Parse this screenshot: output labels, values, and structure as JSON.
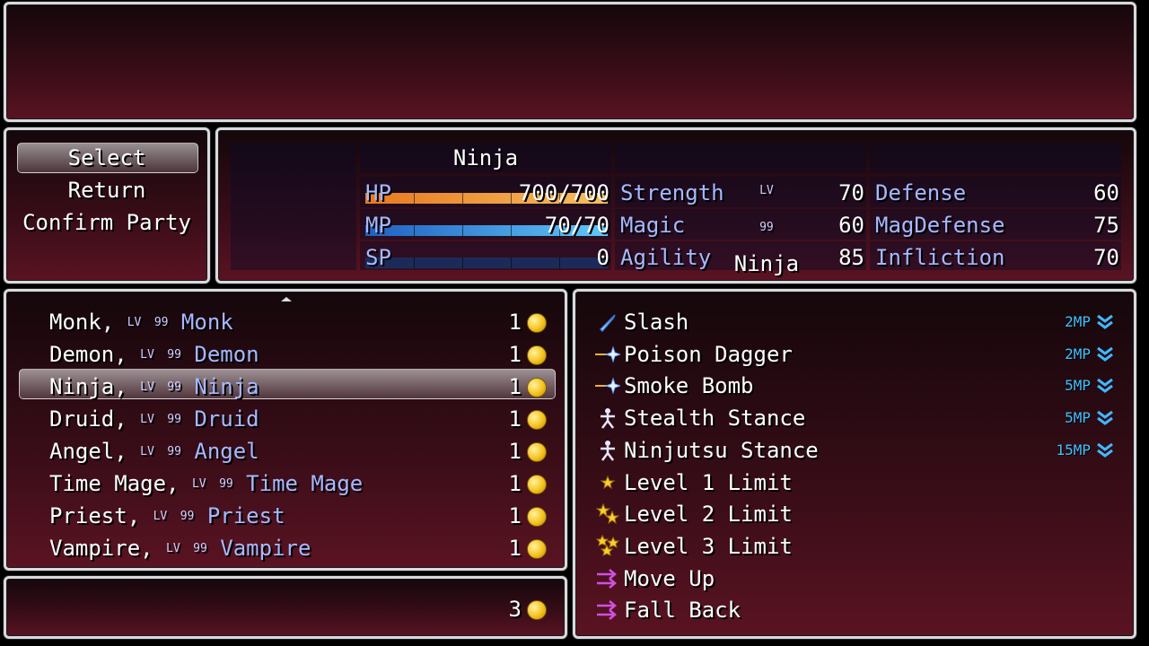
{
  "help": {
    "text": ""
  },
  "command": {
    "items": [
      "Select",
      "Return",
      "Confirm Party"
    ]
  },
  "status": {
    "name": "Ninja",
    "level_label": "LV",
    "level": "99",
    "class": "Ninja",
    "hp_label": "HP",
    "hp_value": "700/700",
    "hp_fill": 1.0,
    "mp_label": "MP",
    "mp_value": "70/70",
    "mp_fill": 1.0,
    "sp_label": "SP",
    "sp_value": "0",
    "sp_fill": 0.0,
    "params": [
      {
        "label": "Strength",
        "value": "70"
      },
      {
        "label": "Defense",
        "value": "60"
      },
      {
        "label": "Magic",
        "value": "60"
      },
      {
        "label": "MagDefense",
        "value": "75"
      },
      {
        "label": "Agility",
        "value": "85"
      },
      {
        "label": "Infliction",
        "value": "70"
      }
    ]
  },
  "party_list": {
    "items": [
      {
        "name": "Monk,",
        "lv": "LV",
        "level": "99",
        "class": "Monk",
        "cost": "1"
      },
      {
        "name": "Demon,",
        "lv": "LV",
        "level": "99",
        "class": "Demon",
        "cost": "1"
      },
      {
        "name": "Ninja,",
        "lv": "LV",
        "level": "99",
        "class": "Ninja",
        "cost": "1"
      },
      {
        "name": "Druid,",
        "lv": "LV",
        "level": "99",
        "class": "Druid",
        "cost": "1"
      },
      {
        "name": "Angel,",
        "lv": "LV",
        "level": "99",
        "class": "Angel",
        "cost": "1"
      },
      {
        "name": "Time Mage,",
        "lv": "LV",
        "level": "99",
        "class": "Time Mage",
        "cost": "1"
      },
      {
        "name": "Priest,",
        "lv": "LV",
        "level": "99",
        "class": "Priest",
        "cost": "1"
      },
      {
        "name": "Vampire,",
        "lv": "LV",
        "level": "99",
        "class": "Vampire",
        "cost": "1"
      }
    ],
    "selected_index": 2
  },
  "total": {
    "value": "3"
  },
  "skills": {
    "items": [
      {
        "name": "Slash",
        "icon": "dagger-icon",
        "cost": "2MP"
      },
      {
        "name": "Poison Dagger",
        "icon": "thrown-star-icon",
        "cost": "2MP"
      },
      {
        "name": "Smoke Bomb",
        "icon": "thrown-star-icon",
        "cost": "5MP"
      },
      {
        "name": "Stealth Stance",
        "icon": "stance-figure-icon",
        "cost": "5MP"
      },
      {
        "name": "Ninjutsu Stance",
        "icon": "stance-figure-icon",
        "cost": "15MP"
      },
      {
        "name": "Level 1 Limit",
        "icon": "one-star-icon",
        "cost": ""
      },
      {
        "name": "Level 2 Limit",
        "icon": "two-stars-icon",
        "cost": ""
      },
      {
        "name": "Level 3 Limit",
        "icon": "three-stars-icon",
        "cost": ""
      },
      {
        "name": "Move Up",
        "icon": "arrows-right-icon",
        "cost": ""
      },
      {
        "name": "Fall Back",
        "icon": "arrows-right-icon",
        "cost": ""
      }
    ]
  },
  "colors": {
    "hp_gauge": "#f0a030",
    "mp_gauge": "#40a0e0",
    "coin": "#f4c21d",
    "mp_cost": "#40c0ff",
    "system_blue": "#a7b8ff"
  }
}
